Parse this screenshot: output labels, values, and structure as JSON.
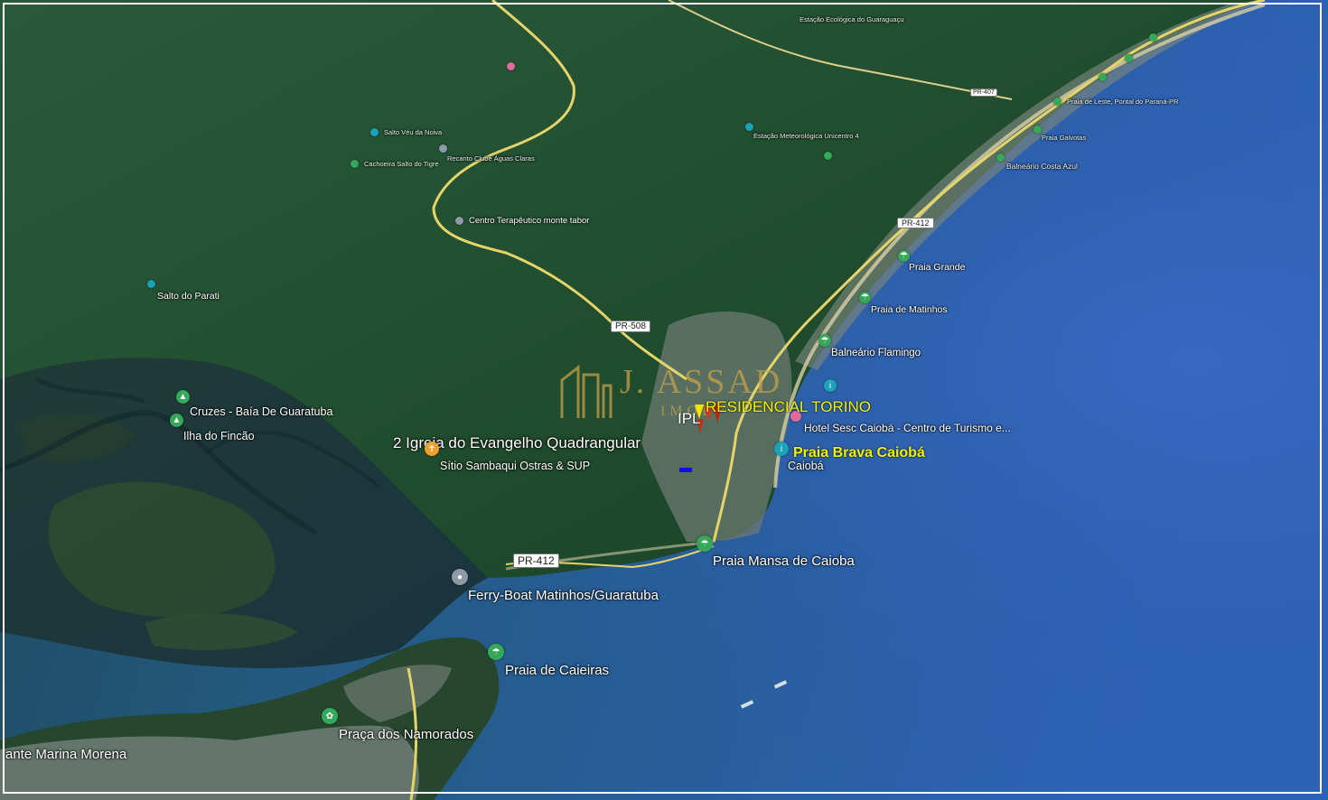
{
  "colors": {
    "ocean_deep": "#2f63b8",
    "ocean_shallow": "#1f4a5e",
    "forest": "#1e4a2a",
    "road": "#e5d46a",
    "poi_green": "#35a85a",
    "poi_teal": "#1aa3b8",
    "poi_orange": "#f0a030",
    "poi_gray": "#8e9aa8",
    "label_yellow": "#f2f200"
  },
  "places": {
    "estacao_ecologica": "Estação Ecológica do Guaraguaçu",
    "salto_veu": "Salto Véu da Noiva",
    "clube_aguas": "Recanto Clube Águas Claras",
    "cachoeira_tigre": "Cachoeira Salto do Tigre",
    "centro_monte": "Centro Terapêutico monte tabor",
    "salto_parati": "Salto do Parati",
    "estacao_meteo": "Estação Meteorológica Unicentro 4",
    "praia_leste": "Praia de Leste, Pontal do Paraná-PR",
    "praia_gaivotas": "Praia Gaivotas",
    "balneario_costa": "Balneário Costa Azul",
    "praia_grande": "Praia Grande",
    "praia_matinhos": "Praia de Matinhos",
    "balneario_flamingo": "Balneário Flamingo",
    "hotel_sesc": "Hotel Sesc Caiobá - Centro de Turismo e...",
    "caioba": "Caiobá",
    "cruzes": "Cruzes - Baía De Guaratuba",
    "ilha_fincao": "Ilha do Fincão",
    "igreja": "2 Igreja do Evangelho Quadrangular",
    "sitio": "Sítio Sambaqui Ostras & SUP",
    "praia_mansa": "Praia Mansa de Caioba",
    "ferry": "Ferry-Boat Matinhos/Guaratuba",
    "praia_caieiras": "Praia de Caieiras",
    "praca_namorados": "Praça dos Namorados",
    "marina": "ante Marina Morena"
  },
  "roads": {
    "pr407": "PR-407",
    "pr412_north": "PR-412",
    "pr508": "PR-508",
    "pr412_south": "PR-412"
  },
  "highlight": {
    "residencial": "RESIDENCIAL TORINO",
    "brava": "Praia Brava Caiobá",
    "ipl": "IPL"
  },
  "brand": {
    "name": "J. ASSAD",
    "sub": "IMOB"
  },
  "icons": {
    "park": "tree-icon",
    "beach": "umbrella-icon",
    "info": "info-icon",
    "church": "church-icon",
    "ferry": "pin-icon",
    "hotel": "hotel-icon"
  }
}
